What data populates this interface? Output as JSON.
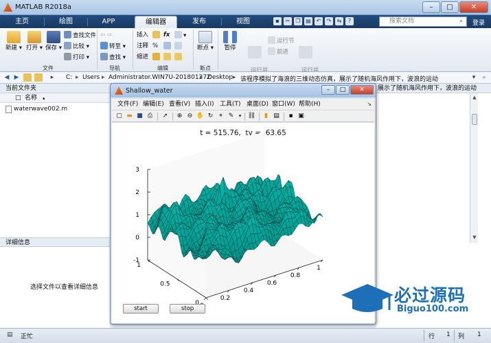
{
  "window": {
    "title": "MATLAB R2018a"
  },
  "ribbon": {
    "tabs": [
      {
        "label": "主页",
        "active": false
      },
      {
        "label": "绘图",
        "active": false
      },
      {
        "label": "APP",
        "active": false
      },
      {
        "label": "编辑器",
        "active": true
      },
      {
        "label": "发布",
        "active": false
      },
      {
        "label": "视图",
        "active": false
      }
    ],
    "search_placeholder": "搜索文档",
    "signin": "登录",
    "file_group": {
      "label": "文件",
      "new": "新建",
      "open": "打开",
      "save": "保存",
      "find_files": "查找文件",
      "compare": "比较",
      "print": "打印"
    },
    "nav_group": {
      "label": "导航",
      "goto": "转至",
      "find": "查找"
    },
    "edit_group": {
      "label": "编辑",
      "insert": "插入",
      "comment": "注释",
      "indent": "缩进",
      "fx": "fx"
    },
    "breakpoint_group": {
      "label": "断点",
      "breakpoints": "断点"
    },
    "run_group": {
      "pause": "暂停",
      "run_advance": "运行并\n前进",
      "run_section": "运行节",
      "advance": "前进",
      "run_time": "运行并\n计时"
    }
  },
  "address": {
    "crumbs": [
      "C:",
      "Users",
      "Administrator.WIN7U-20180127Z",
      "Desktop",
      "该程序模拟了海浪的三维动态仿真，展示了随机海风作用下，波浪的运动"
    ]
  },
  "file_browser": {
    "title": "当前文件夹",
    "column_name": "名称",
    "files": [
      "waterwave002.m"
    ]
  },
  "details": {
    "title": "详细信息",
    "message": "选择文件以查看详细信息"
  },
  "right_panel": {
    "title": "展示了随机海风作用下，波浪的运动"
  },
  "statusbar": {
    "status": "正忙",
    "row_label": "行",
    "row_value": "1",
    "col_label": "列",
    "col_value": "1"
  },
  "figure": {
    "title": "Shallow_water",
    "menus": [
      "文件(F)",
      "编辑(E)",
      "查看(V)",
      "插入(I)",
      "工具(T)",
      "桌面(D)",
      "窗口(W)",
      "帮助(H)"
    ],
    "plot_title": "t = 515.76,  tv =  63.65",
    "buttons": {
      "start": "start",
      "stop": "stop"
    }
  },
  "chart_data": {
    "type": "surface",
    "title": "t = 515.76,  tv =  63.65",
    "xlabel": "",
    "ylabel": "",
    "zlabel": "",
    "x_ticks": [
      0,
      0.2,
      0.4,
      0.6,
      0.8,
      1
    ],
    "y_ticks": [
      0,
      0.5,
      1
    ],
    "z_ticks": [
      -1,
      0,
      1,
      2,
      3
    ],
    "xlim": [
      0,
      1
    ],
    "ylim": [
      0,
      1
    ],
    "zlim": [
      -1,
      3
    ],
    "surface_color": "#00d0c8",
    "peak_z": 2.8
  },
  "watermark": {
    "cn": "必过源码",
    "url": "Biguo100.com"
  }
}
